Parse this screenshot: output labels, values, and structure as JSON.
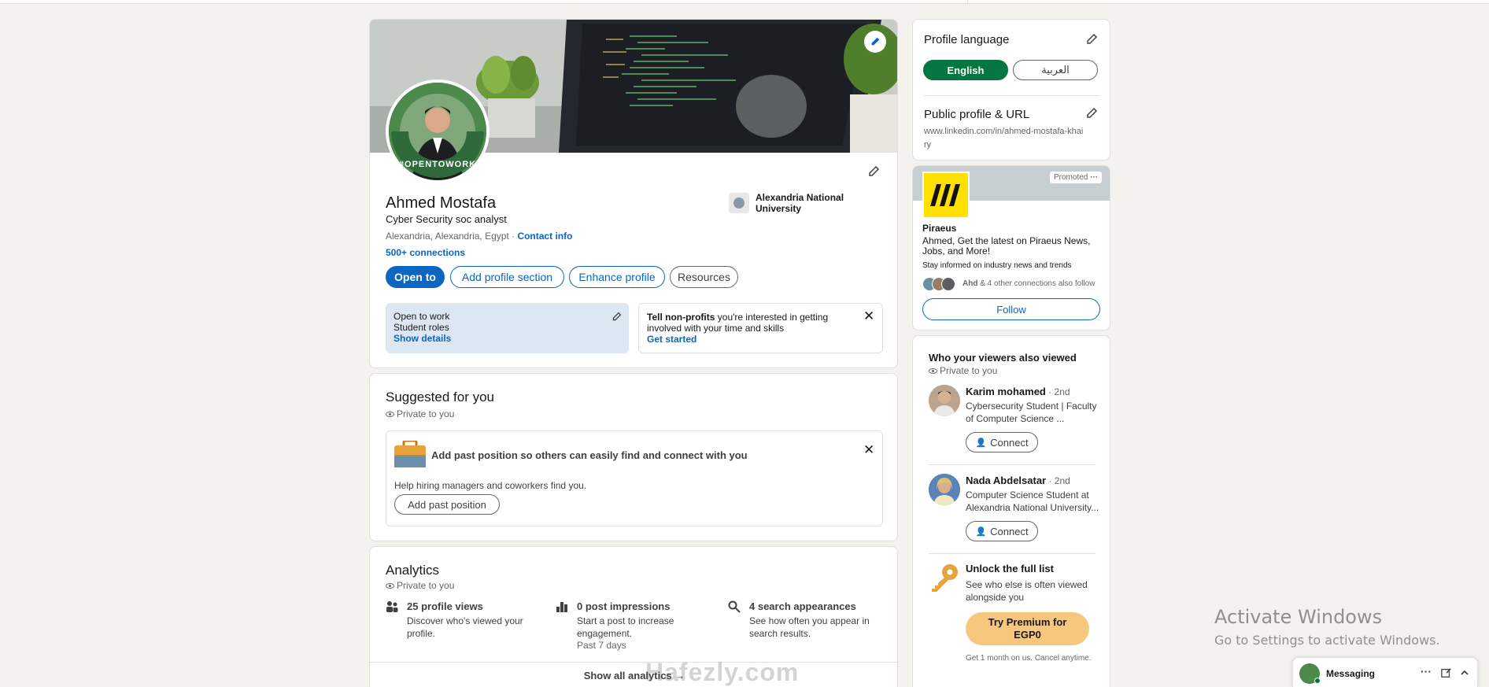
{
  "profile": {
    "name": "Ahmed Mostafa",
    "headline": "Cyber Security soc analyst",
    "location": "Alexandria, Alexandria, Egypt",
    "location_sep": " · ",
    "contact_info": "Contact info",
    "connections": "500+ connections",
    "education": "Alexandria National University",
    "open_to_work_badge": "#OPENTOWORK",
    "buttons": {
      "open_to": "Open to",
      "add_section": "Add profile section",
      "enhance": "Enhance profile",
      "resources": "Resources"
    },
    "open_to_work": {
      "title": "Open to work",
      "roles": "Student roles",
      "show_details": "Show details"
    },
    "nonprofit": {
      "bold": "Tell non-profits",
      "text": " you're interested in getting involved with your time and skills",
      "cta": "Get started"
    }
  },
  "suggested": {
    "title": "Suggested for you",
    "private": "Private to you",
    "card_title": "Add past position so others can easily find and connect with you",
    "card_text": "Help hiring managers and coworkers find you.",
    "button": "Add past position"
  },
  "analytics": {
    "title": "Analytics",
    "private": "Private to you",
    "items": [
      {
        "title": "25 profile views",
        "desc": "Discover who's viewed your profile.",
        "sub": ""
      },
      {
        "title": "0 post impressions",
        "desc": "Start a post to increase engagement.",
        "sub": "Past 7 days"
      },
      {
        "title": "4 search appearances",
        "desc": "See how often you appear in search results.",
        "sub": ""
      }
    ],
    "show_all": "Show all analytics →"
  },
  "sidebar": {
    "profile_language": "Profile language",
    "lang_english": "English",
    "lang_arabic": "العربية",
    "public_profile": "Public profile & URL",
    "profile_url": "www.linkedin.com/in/ahmed-mostafa-khairy"
  },
  "ad": {
    "promoted": "Promoted",
    "company": "Piraeus",
    "headline": "Ahmed, Get the latest on Piraeus News, Jobs, and More!",
    "sub": "Stay informed on industry news and trends",
    "social_bold": "Ahd",
    "social_rest": " & 4 other connections also follow",
    "follow": "Follow"
  },
  "viewers": {
    "title": "Who your viewers also viewed",
    "private": "Private to you",
    "people": [
      {
        "name": "Karim mohamed",
        "degree": " · 2nd",
        "desc": "Cybersecurity Student | Faculty of Computer Science ...",
        "button": "Connect"
      },
      {
        "name": "Nada Abdelsatar",
        "degree": " · 2nd",
        "desc": "Computer Science Student at Alexandria National University...",
        "button": "Connect"
      }
    ],
    "unlock_title": "Unlock the full list",
    "unlock_text": "See who else is often viewed alongside you",
    "premium_btn": "Try Premium for EGP0",
    "premium_note": "Get 1 month on us. Cancel anytime."
  },
  "windows": {
    "activate": "Activate Windows",
    "goto": "Go to Settings to activate Windows."
  },
  "messaging": {
    "label": "Messaging"
  },
  "watermark": "Hafezly.com",
  "colors": {
    "brand": "#0a66c2",
    "open_green": "#057642",
    "premium": "#f8c77e"
  }
}
